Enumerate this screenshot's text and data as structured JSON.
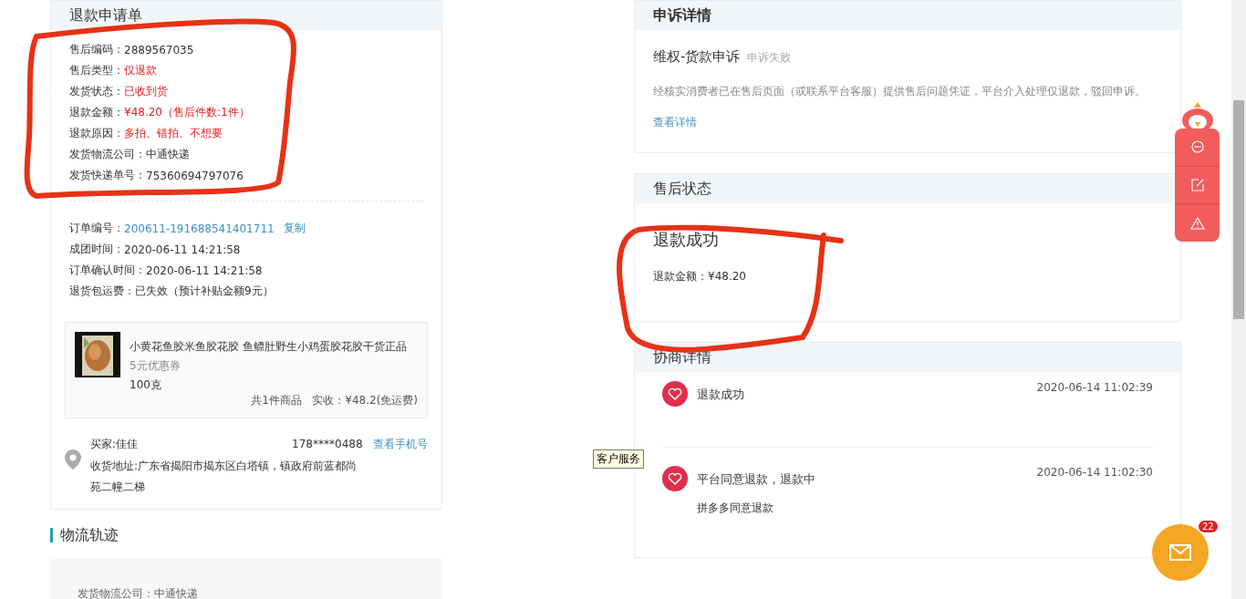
{
  "refund_form": {
    "title": "退款申请单",
    "aftersale_rows": [
      {
        "label": "售后编码：",
        "value": "2889567035",
        "highlight": false
      },
      {
        "label": "售后类型：",
        "value": "仅退款",
        "highlight": true
      },
      {
        "label": "发货状态：",
        "value": "已收到货",
        "highlight": true
      },
      {
        "label": "退款金额：",
        "value": "¥48.20（售后件数:1件）",
        "highlight": true
      },
      {
        "label": "退款原因：",
        "value": "多拍、错拍、不想要",
        "highlight": true
      },
      {
        "label": "发货物流公司：",
        "value": "中通快递",
        "highlight": false
      },
      {
        "label": "发货快递单号：",
        "value": "75360694797076",
        "highlight": false
      }
    ],
    "order_rows": [
      {
        "label": "订单编号：",
        "value": "200611-191688541401711",
        "kind": "link",
        "action": "复制"
      },
      {
        "label": "成团时间：",
        "value": "2020-06-11 14:21:58",
        "kind": "text"
      },
      {
        "label": "订单确认时间：",
        "value": "2020-06-11 14:21:58",
        "kind": "text"
      },
      {
        "label": "退货包运费：",
        "value": "已失效（预计补贴金额9元）",
        "kind": "text"
      }
    ],
    "product": {
      "name": "小黄花鱼胶米鱼胶花胶 鱼鳔肚野生小鸡蛋胶花胶干货正品",
      "coupon": "5元优惠券",
      "spec": "100克",
      "count": "共1件商品",
      "paid": "实收：¥48.2(免运费)"
    },
    "buyer": {
      "name": "买家:佳佳",
      "phone": "178****0488",
      "phone_link": "查看手机号",
      "address": "收货地址:广东省揭阳市揭东区白塔镇，镇政府前蓝都尚苑二幢二梯"
    }
  },
  "logistics": {
    "title": "物流轨迹",
    "line": "发货物流公司：中通快递"
  },
  "appeal": {
    "title": "申诉详情",
    "name": "维权-货款申诉",
    "status": "申诉失败",
    "description": "经核实消费者已在售后页面（或联系平台客服）提供售后问题凭证，平台介入处理仅退款，驳回申诉。",
    "link": "查看详情"
  },
  "aftersale_status": {
    "title": "售后状态",
    "status": "退款成功",
    "amount": "退款金额：¥48.20"
  },
  "negotiation": {
    "title": "协商详情",
    "entries": [
      {
        "title": "退款成功",
        "time": "2020-06-14 11:02:39"
      },
      {
        "title": "平台同意退款，退款中",
        "time": "2020-06-14 11:02:30",
        "note": "拼多多同意退款"
      }
    ]
  },
  "tooltip": "客户服务",
  "mail_badge": "22"
}
